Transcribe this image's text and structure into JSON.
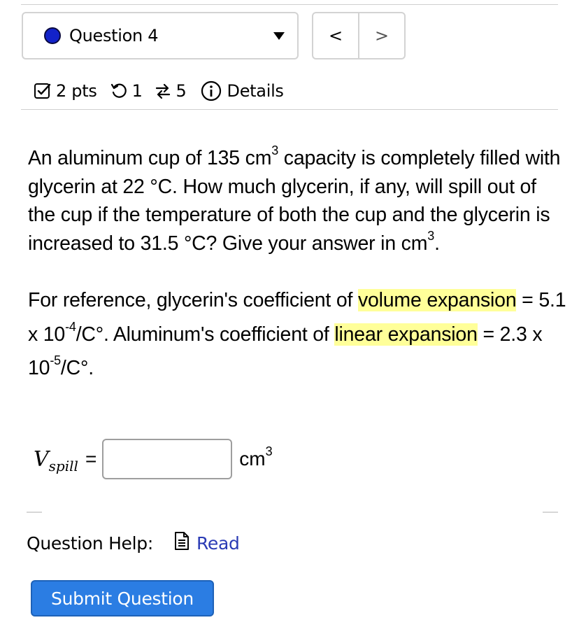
{
  "question_nav": {
    "selected": "Question 4",
    "prev_label": "<",
    "next_label": ">"
  },
  "meta": {
    "points": "2 pts",
    "attempts": "1",
    "versions": "5",
    "details_label": "Details"
  },
  "question": {
    "p1_a": "An aluminum cup of 135 cm",
    "p1_sup": "3",
    "p1_b": " capacity is completely filled with glycerin at 22 °C. How much glycerin, if any, will spill out of the cup if the temperature of both the cup and the glycerin is increased to 31.5 °C? Give your answer in cm",
    "p1_sup2": "3",
    "p1_end": ".",
    "p2_a": "For reference, glycerin's coefficient of ",
    "p2_hl1": "volume expansion",
    "p2_b": " = 5.1 x 10",
    "p2_sup1": "-4",
    "p2_c": "/C°.  Aluminum's coefficient of ",
    "p2_hl2": "linear expansion",
    "p2_d": " = 2.3 x 10",
    "p2_sup2": "-5",
    "p2_e": "/C°."
  },
  "answer": {
    "var": "V",
    "sub": "spill",
    "eq": "=",
    "value": "",
    "unit": "cm",
    "unit_sup": "3"
  },
  "help": {
    "label": "Question Help:",
    "read_label": "Read"
  },
  "submit_label": "Submit Question",
  "colors": {
    "highlight": "#ffff99",
    "submit": "#2b7de3",
    "link": "#2a3bb5",
    "question_dot": "#1222c9"
  }
}
